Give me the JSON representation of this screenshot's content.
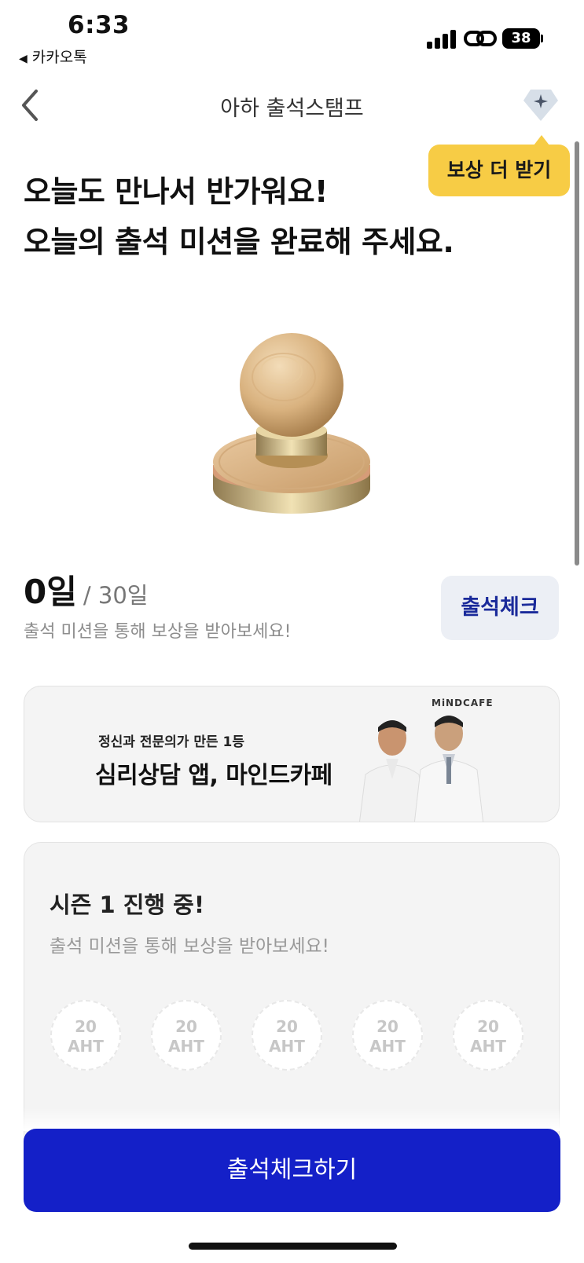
{
  "status_bar": {
    "time": "6:33",
    "back_app_label": "카카오톡",
    "battery_level": "38"
  },
  "nav": {
    "title": "아하 출석스탬프",
    "back_icon": "chevron-left-icon",
    "reward_icon": "diamond-sparkle-icon"
  },
  "tooltip": {
    "label": "보상 더 받기"
  },
  "headline": {
    "line1": "오늘도 만나서 반가워요!",
    "line2": "오늘의 출석 미션을 완료해 주세요."
  },
  "progress": {
    "current": "0일",
    "total": "/ 30일",
    "description": "출석 미션을 통해 보상을 받아보세요!",
    "check_button": "출석체크"
  },
  "banner": {
    "brand": "MiNDCAFE",
    "subtitle": "정신과 전문의가 만든 1등",
    "title": "심리상담 앱, 마인드카페"
  },
  "season": {
    "title": "시즌 1 진행 중!",
    "description": "출석 미션을 통해 보상을 받아보세요!",
    "rewards": [
      {
        "amount": "20",
        "unit": "AHT"
      },
      {
        "amount": "20",
        "unit": "AHT"
      },
      {
        "amount": "20",
        "unit": "AHT"
      },
      {
        "amount": "20",
        "unit": "AHT"
      },
      {
        "amount": "20",
        "unit": "AHT"
      }
    ]
  },
  "cta": {
    "label": "출석체크하기"
  },
  "colors": {
    "primary": "#1420c8",
    "tooltip": "#f7cc45",
    "check_button_bg": "#eceff5",
    "check_button_text": "#1a2a9a"
  }
}
